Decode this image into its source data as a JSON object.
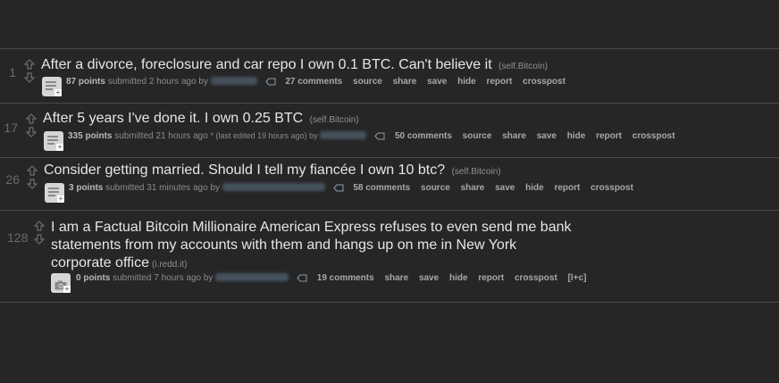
{
  "posts": [
    {
      "rank": "1",
      "title": "After a divorce, foreclosure and car repo I own 0.1 BTC. Can't believe it",
      "domain": "(self.Bitcoin)",
      "points": "87 points",
      "submitted": "submitted 2 hours ago by",
      "edited": "",
      "buttons": [
        "27 comments",
        "source",
        "share",
        "save",
        "hide",
        "report",
        "crosspost"
      ],
      "thumb": "self-post-icon"
    },
    {
      "rank": "17",
      "title": "After 5 years I've done it. I own 0.25 BTC",
      "domain": "(self.Bitcoin)",
      "points": "335 points",
      "submitted": "submitted 21 hours ago",
      "edited": "* (last edited 19 hours ago) by",
      "buttons": [
        "50 comments",
        "source",
        "share",
        "save",
        "hide",
        "report",
        "crosspost"
      ],
      "thumb": "self-post-icon"
    },
    {
      "rank": "26",
      "title": "Consider getting married. Should I tell my fiancée I own 10 btc?",
      "domain": "(self.Bitcoin)",
      "points": "3 points",
      "submitted": "submitted 31 minutes ago by",
      "edited": "",
      "buttons": [
        "58 comments",
        "source",
        "share",
        "save",
        "hide",
        "report",
        "crosspost"
      ],
      "thumb": "self-post-icon"
    },
    {
      "rank": "128",
      "title_lines": [
        "I am a Factual Bitcoin Millionaire American Express refuses to even send me bank",
        "statements from my accounts with them and hangs up on me in New York",
        "corporate office"
      ],
      "domain": "(i.redd.it)",
      "points": "0 points",
      "submitted": "submitted 7 hours ago by",
      "edited": "",
      "buttons": [
        "19 comments",
        "share",
        "save",
        "hide",
        "report",
        "crosspost",
        "[l+c]"
      ],
      "thumb": "camera-icon"
    }
  ],
  "colors": {
    "background": "#262626",
    "divider": "#4a4a4a",
    "title": "#e6e6e6",
    "tagline": "#8c8c8c",
    "buttons": "#a8a8a8"
  }
}
